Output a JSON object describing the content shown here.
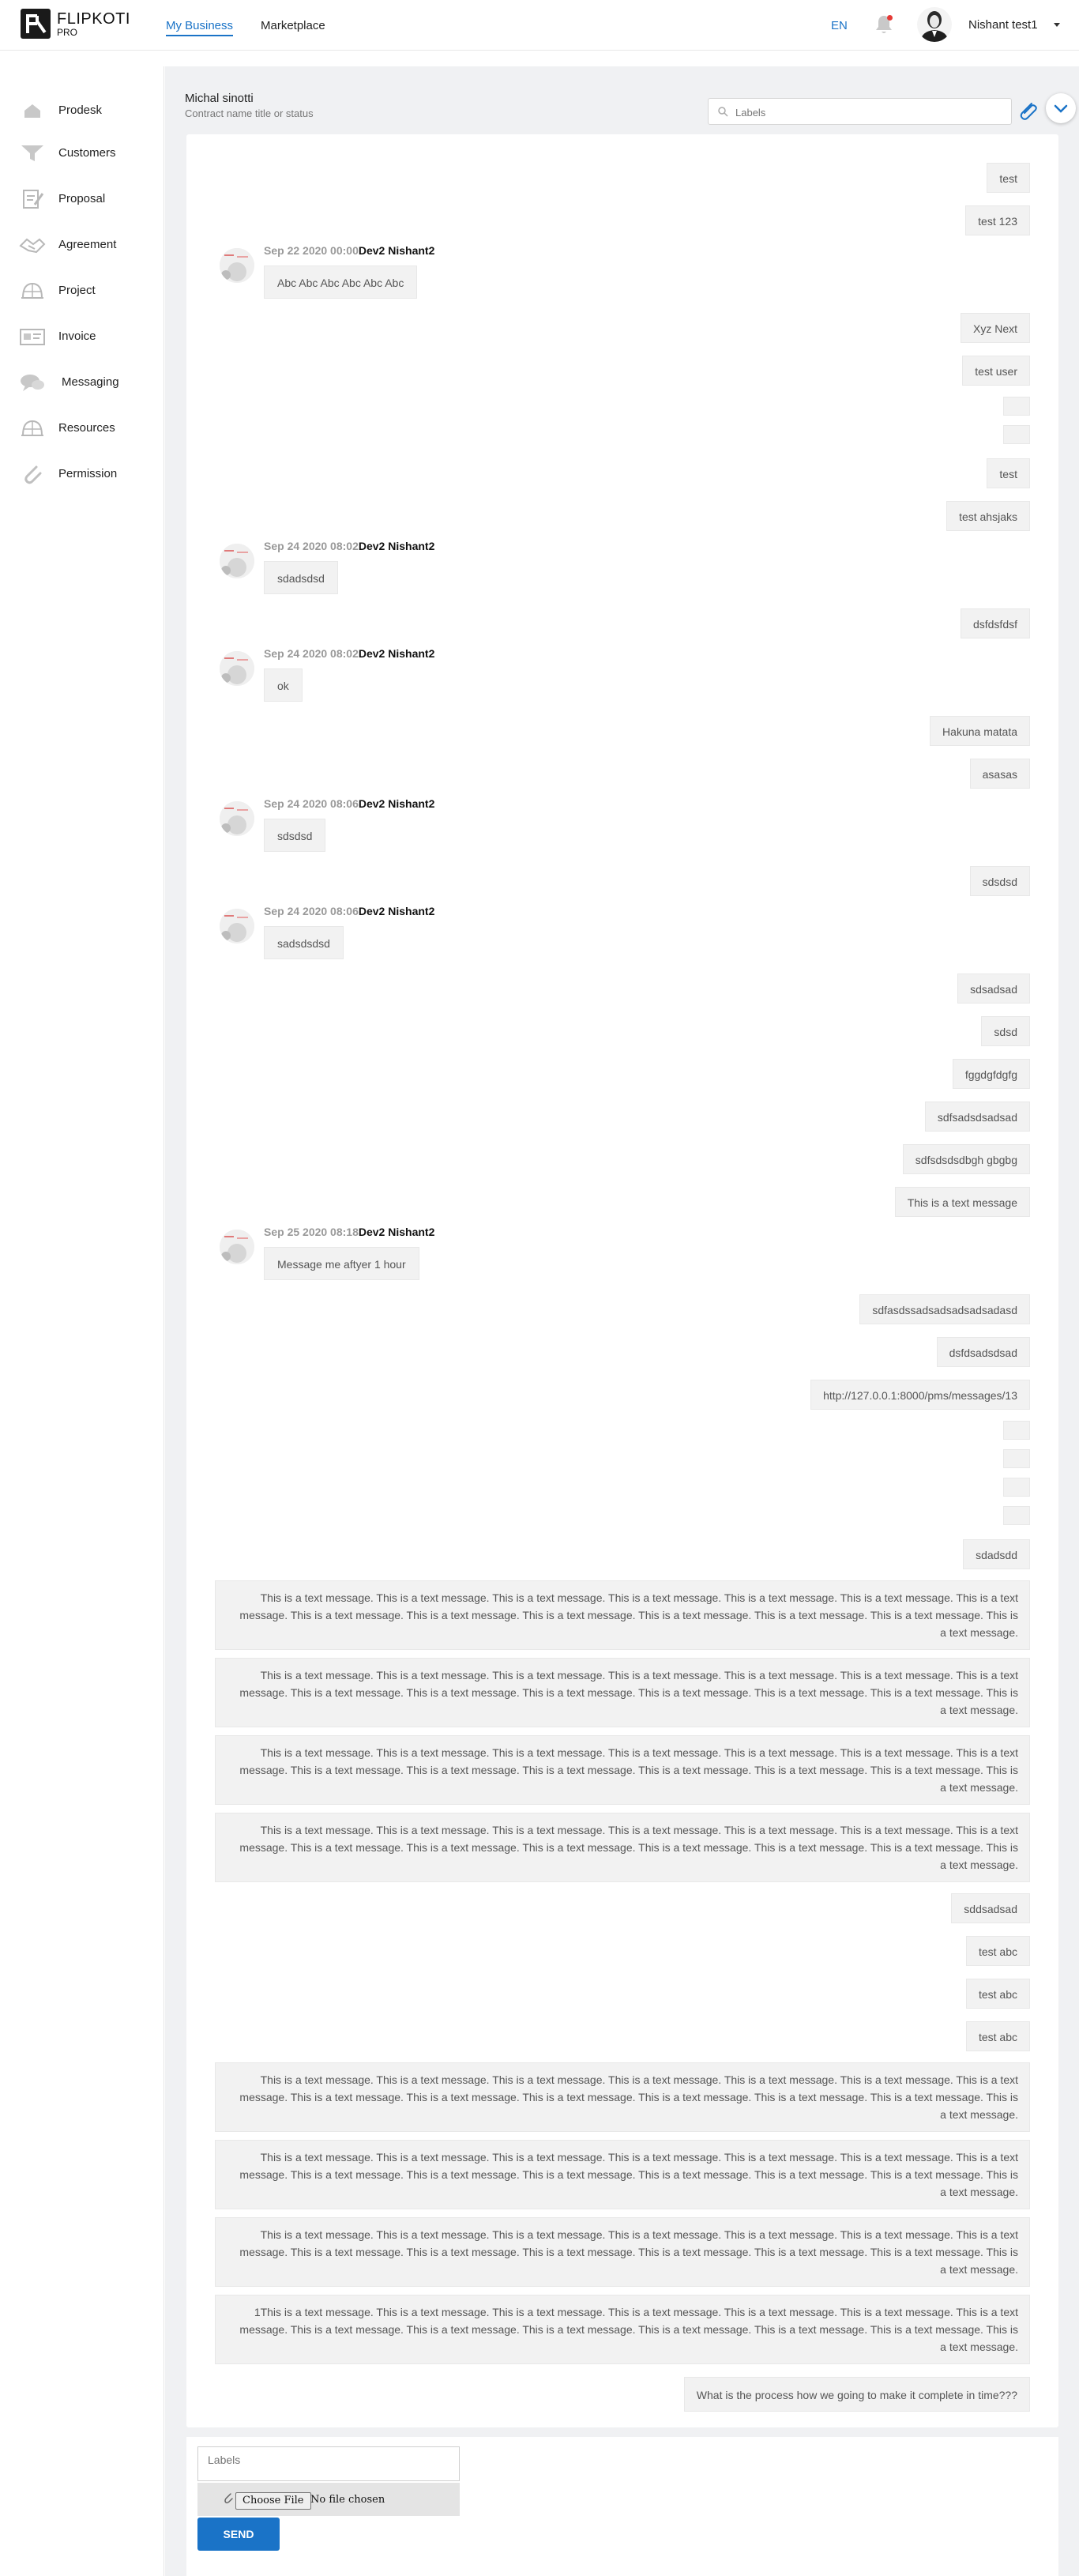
{
  "brand": {
    "name": "FLIPKOTI",
    "sub": "PRO"
  },
  "topnav": {
    "tabs": [
      {
        "label": "My Business"
      },
      {
        "label": "Marketplace"
      }
    ],
    "language": "EN",
    "user_name": "Nishant test1"
  },
  "sidebar": {
    "items": [
      {
        "label": "Prodesk",
        "icon": "house-icon"
      },
      {
        "label": "Customers",
        "icon": "funnel-icon"
      },
      {
        "label": "Proposal",
        "icon": "document-pen-icon"
      },
      {
        "label": "Agreement",
        "icon": "handshake-icon"
      },
      {
        "label": "Project",
        "icon": "dome-icon"
      },
      {
        "label": "Invoice",
        "icon": "invoice-icon"
      },
      {
        "label": "Messaging",
        "icon": "chat-bubbles-icon"
      },
      {
        "label": "Resources",
        "icon": "dome-icon"
      },
      {
        "label": "Permission",
        "icon": "paperclip-icon"
      }
    ]
  },
  "header": {
    "contact_name": "Michal sinotti",
    "contact_subtitle": "Contract name title or status",
    "labels_placeholder": "Labels"
  },
  "colors": {
    "accent": "#1a73c7",
    "bubble": "#f2f2f2",
    "background": "#f0f1f3"
  },
  "long_text": "This is a text message. This is a text message. This is a text message. This is a text message. This is a text message. This is a text message. This is a text message. This is a text message. This is a text message. This is a text message. This is a text message. This is a text message. This is a text message. This is a text message.",
  "long_text_1": "1This is a text message. This is a text message. This is a text message. This is a text message. This is a text message. This is a text message. This is a text message. This is a text message. This is a text message. This is a text message. This is a text message. This is a text message. This is a text message. This is a text message.",
  "messages": {
    "m1": "test",
    "m2": "test 123",
    "in1": {
      "date": "Sep 22 2020 00:00",
      "sender": "Dev2 Nishant2",
      "text": "Abc Abc Abc Abc Abc Abc"
    },
    "m3": "Xyz Next",
    "m4": "test user",
    "m5": "test",
    "m6": "test ahsjaks",
    "in2": {
      "date": "Sep 24 2020 08:02",
      "sender": "Dev2 Nishant2",
      "text": "sdadsdsd"
    },
    "m7": "dsfdsfdsf",
    "in3": {
      "date": "Sep 24 2020 08:02",
      "sender": "Dev2 Nishant2",
      "text": "ok"
    },
    "m8": "Hakuna matata",
    "m9": "asasas",
    "in4": {
      "date": "Sep 24 2020 08:06",
      "sender": "Dev2 Nishant2",
      "text": "sdsdsd"
    },
    "m10": "sdsdsd",
    "in5": {
      "date": "Sep 24 2020 08:06",
      "sender": "Dev2 Nishant2",
      "text": "sadsdsdsd"
    },
    "m11": "sdsadsad",
    "m12": "sdsd",
    "m13": "fggdgfdgfg",
    "m14": "sdfsadsdsadsad",
    "m15": "sdfsdsdsdbgh gbgbg",
    "m16": "This is a text message",
    "in6": {
      "date": "Sep 25 2020 08:18",
      "sender": "Dev2 Nishant2",
      "text": "Message me aftyer 1 hour"
    },
    "m17": "sdfasdssadsadsadsadsadasd",
    "m18": "dsfdsadsdsad",
    "m19": "http://127.0.0.1:8000/pms/messages/13",
    "m20": "sdadsdd",
    "m21": "sddsadsad",
    "m22": "test abc",
    "m23": "test abc",
    "m24": "test abc",
    "m25": "What is the process how we going to make it complete in time???"
  },
  "composer": {
    "labels_placeholder": "Labels",
    "file_button": "Choose File",
    "file_status": "No file chosen",
    "send_label": "SEND"
  }
}
